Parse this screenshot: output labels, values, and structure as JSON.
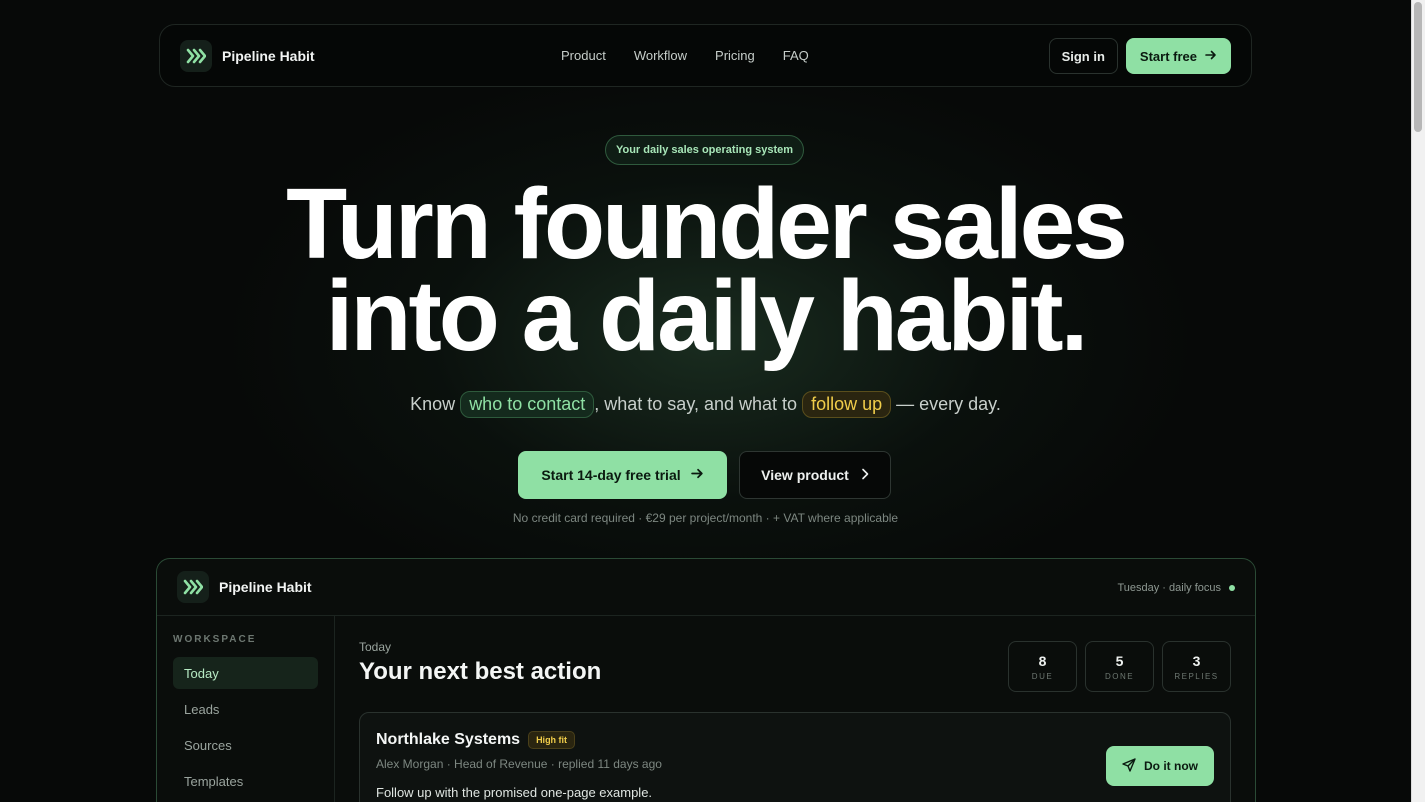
{
  "brand": {
    "name": "Pipeline Habit",
    "icon": "chevrons-right-icon"
  },
  "nav": {
    "links": [
      "Product",
      "Workflow",
      "Pricing",
      "FAQ"
    ],
    "sign_in": "Sign in",
    "start_free": "Start free"
  },
  "hero": {
    "pill": "Your daily sales operating system",
    "headline_line1": "Turn founder sales",
    "headline_line2": "into a daily habit.",
    "sub_prefix": "Know",
    "sub_highlight1": "who to contact",
    "sub_middle": ", what to say, and what to",
    "sub_highlight2": "follow up",
    "sub_suffix": "— every day.",
    "cta_primary": "Start 14-day free trial",
    "cta_secondary": "View product",
    "fineprint": "No credit card required · €29 per project/month · + VAT where applicable"
  },
  "app": {
    "brand": "Pipeline Habit",
    "focus": "Tuesday · daily focus",
    "sidebar": {
      "section": "WORKSPACE",
      "items": [
        "Today",
        "Leads",
        "Sources",
        "Templates"
      ],
      "active": "Today"
    },
    "main": {
      "eyebrow": "Today",
      "title": "Your next best action",
      "stats": [
        {
          "value": "8",
          "label": "DUE"
        },
        {
          "value": "5",
          "label": "DONE"
        },
        {
          "value": "3",
          "label": "REPLIES"
        }
      ],
      "card": {
        "company": "Northlake Systems",
        "badge": "High fit",
        "meta": "Alex Morgan · Head of Revenue · replied 11 days ago",
        "note": "Follow up with the promised one-page example.",
        "action": "Do it now"
      }
    }
  },
  "colors": {
    "accent": "#8fe0a4",
    "highlight_yellow": "#f0cd4a",
    "background": "#070908"
  }
}
